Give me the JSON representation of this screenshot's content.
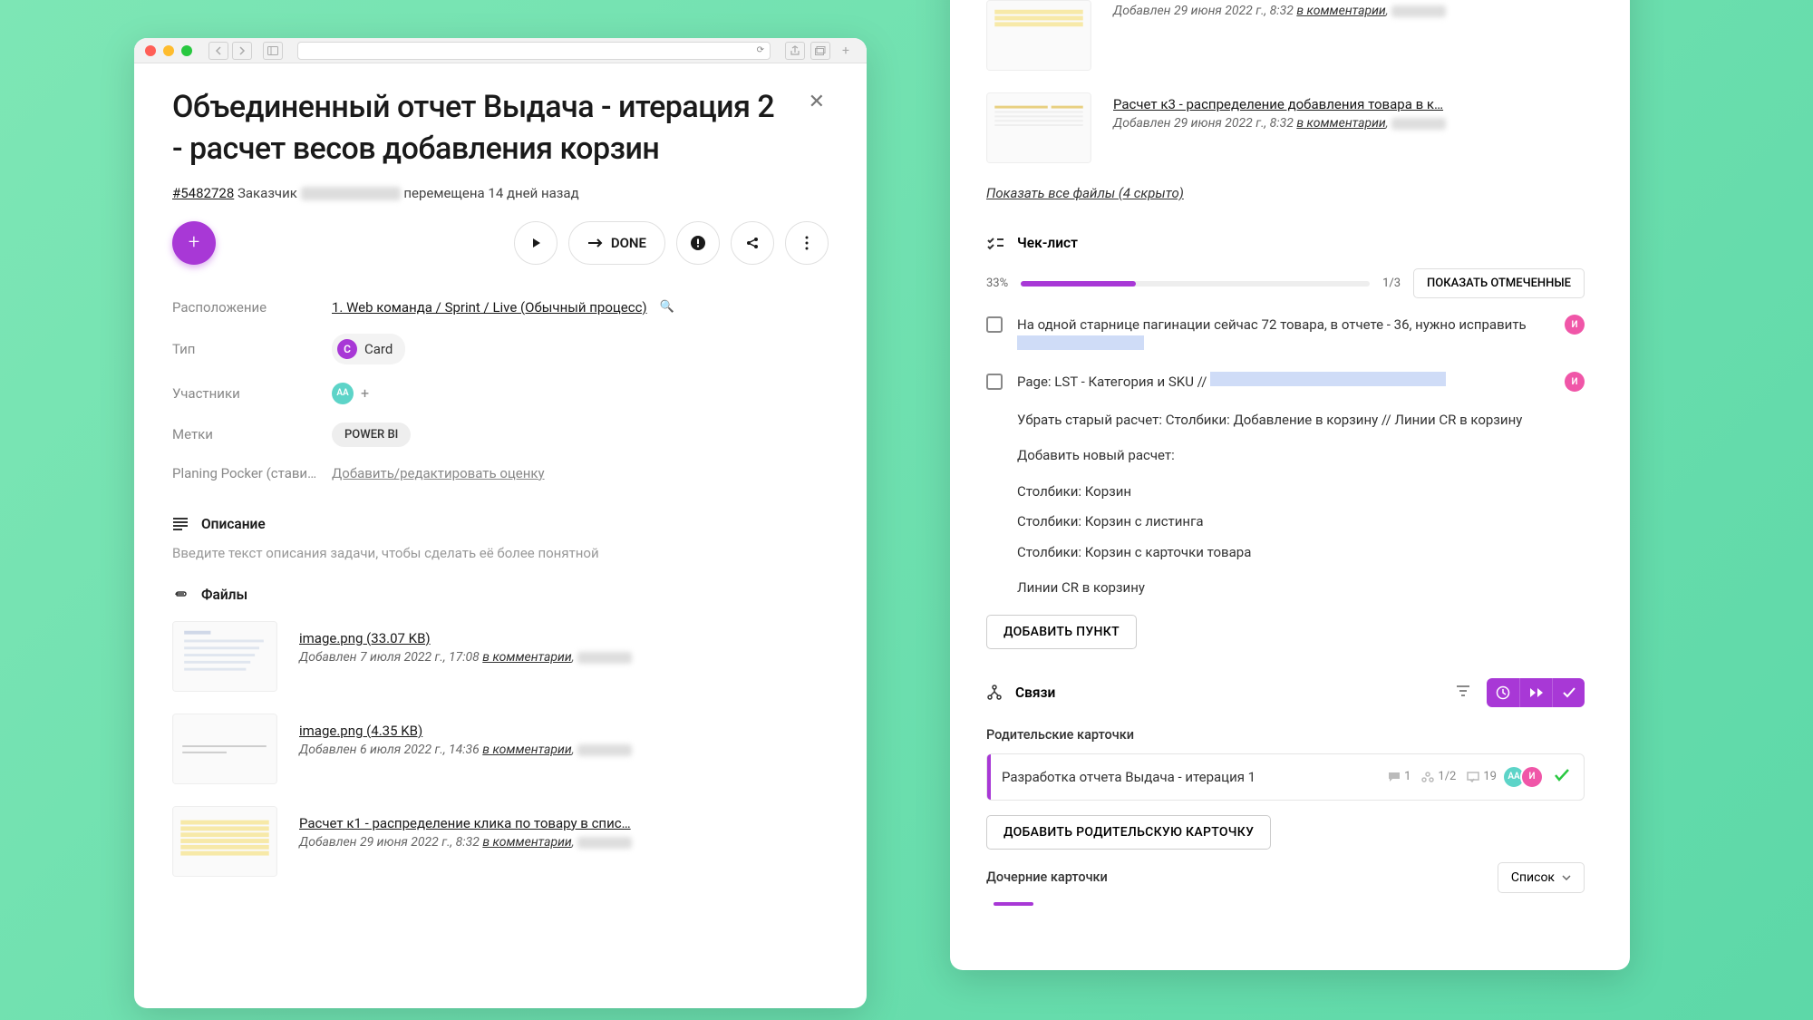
{
  "left": {
    "title": "Объединенный отчет Выдача - итерация 2 - расчет весов добавления корзин",
    "id": "#5482728",
    "customer_label": "Заказчик",
    "moved_text": "перемещена 14 дней назад",
    "done_label": "DONE",
    "rows": {
      "location_label": "Расположение",
      "location_value": "1. Web команда / Sprint / Live (Обычный процесс)",
      "type_label": "Тип",
      "type_value": "Card",
      "type_initial": "C",
      "assignees_label": "Участники",
      "assignee_initials": "АА",
      "tags_label": "Метки",
      "tag": "POWER BI",
      "poker_label": "Planing Pocker (стави…",
      "poker_action": "Добавить/редактировать оценку"
    },
    "description": {
      "header": "Описание",
      "placeholder": "Введите текст описания задачи, чтобы сделать её более понятной"
    },
    "files_header": "Файлы",
    "files": [
      {
        "name": "image.png (33.07 KB)",
        "meta_prefix": "Добавлен 7 июля 2022 г., 17:08 ",
        "meta_link": "в комментарии"
      },
      {
        "name": "image.png (4.35 KB)",
        "meta_prefix": "Добавлен 6 июля 2022 г., 14:36 ",
        "meta_link": "в комментарии"
      },
      {
        "name": "Расчет к1 - распределение клика по товару в спис…",
        "meta_prefix": "Добавлен 29 июня 2022 г., 8:32 ",
        "meta_link": "в комментарии"
      }
    ]
  },
  "right": {
    "files": [
      {
        "meta_prefix": "Добавлен 29 июня 2022 г., 8:32 ",
        "meta_link": "в комментарии"
      },
      {
        "name": "Расчет к3 - распределение добавления товара в к…",
        "meta_prefix": "Добавлен 29 июня 2022 г., 8:32 ",
        "meta_link": "в комментарии"
      }
    ],
    "show_all": "Показать все файлы (4 скрыто)",
    "checklist": {
      "header": "Чек-лист",
      "percent": "33%",
      "count": "1/3",
      "toggle": "ПОКАЗАТЬ ОТМЕЧЕННЫЕ",
      "item1": "На одной старнице пагинации сейчас 72 товара, в отчете - 36, нужно исправить",
      "item2_prefix": "Page: LST - Категория и SKU // ",
      "details_l1": "Убрать старый расчет: Столбики: Добавление в корзину // Линии CR в корзину",
      "details_l2": "Добавить  новый расчет:",
      "details_l3": "Столбики: Корзин",
      "details_l4": "Столбики: Корзин с листинга",
      "details_l5": "Столбики: Корзин с карточки товара",
      "details_l6": "Линии CR в корзину",
      "add_item": "ДОБАВИТЬ ПУНКТ"
    },
    "links": {
      "header": "Связи",
      "parents_label": "Родительские карточки",
      "parent_title": "Разработка отчета Выдача - итерация 1",
      "comment_count": "1",
      "people_count": "1/2",
      "msg_count": "19",
      "add_parent": "ДОБАВИТЬ РОДИТЕЛЬСКУЮ КАРТОЧКУ",
      "children_label": "Дочерние карточки",
      "dropdown": "Список"
    }
  }
}
